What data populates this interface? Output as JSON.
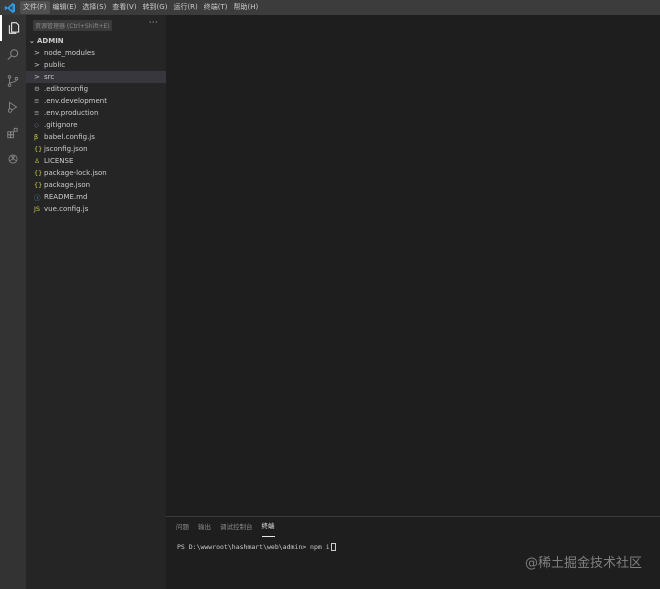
{
  "menu": {
    "items": [
      "文件(F)",
      "编辑(E)",
      "选择(S)",
      "查看(V)",
      "转到(G)",
      "运行(R)",
      "终端(T)",
      "帮助(H)"
    ],
    "active_index": 0
  },
  "sidebar": {
    "title": "资源管理器 (Ctrl+Shift+E)",
    "more": "···",
    "section": "ADMIN",
    "items": [
      {
        "name": "node_modules",
        "kind": "folder",
        "icon": ">"
      },
      {
        "name": "public",
        "kind": "folder",
        "icon": ">"
      },
      {
        "name": "src",
        "kind": "folder",
        "icon": ">",
        "selected": true
      },
      {
        "name": ".editorconfig",
        "kind": "file",
        "icon": "⚙",
        "color": "#a8a8a8"
      },
      {
        "name": ".env.development",
        "kind": "file",
        "icon": "≡",
        "color": "#b8b8b8"
      },
      {
        "name": ".env.production",
        "kind": "file",
        "icon": "≡",
        "color": "#b8b8b8"
      },
      {
        "name": ".gitignore",
        "kind": "file",
        "icon": "◇",
        "color": "#6a7280"
      },
      {
        "name": "babel.config.js",
        "kind": "file",
        "icon": "β",
        "color": "#cbcb41"
      },
      {
        "name": "jsconfig.json",
        "kind": "file",
        "icon": "{}",
        "color": "#cbcb41"
      },
      {
        "name": "LICENSE",
        "kind": "file",
        "icon": "♙",
        "color": "#cbcb41"
      },
      {
        "name": "package-lock.json",
        "kind": "file",
        "icon": "{}",
        "color": "#cbcb41"
      },
      {
        "name": "package.json",
        "kind": "file",
        "icon": "{}",
        "color": "#cbcb41"
      },
      {
        "name": "README.md",
        "kind": "file",
        "icon": "ⓘ",
        "color": "#519aba"
      },
      {
        "name": "vue.config.js",
        "kind": "file",
        "icon": "JS",
        "color": "#cbcb41"
      }
    ]
  },
  "panel": {
    "tabs": [
      "问题",
      "输出",
      "调试控制台",
      "终端"
    ],
    "active_tab": 3,
    "terminal_line": "PS D:\\wwwroot\\hashmart\\web\\admin> npm i"
  },
  "watermark": "@稀土掘金技术社区",
  "activity": [
    "explorer-icon",
    "search-icon",
    "source-control-icon",
    "run-debug-icon",
    "extensions-icon",
    "openai-icon"
  ]
}
